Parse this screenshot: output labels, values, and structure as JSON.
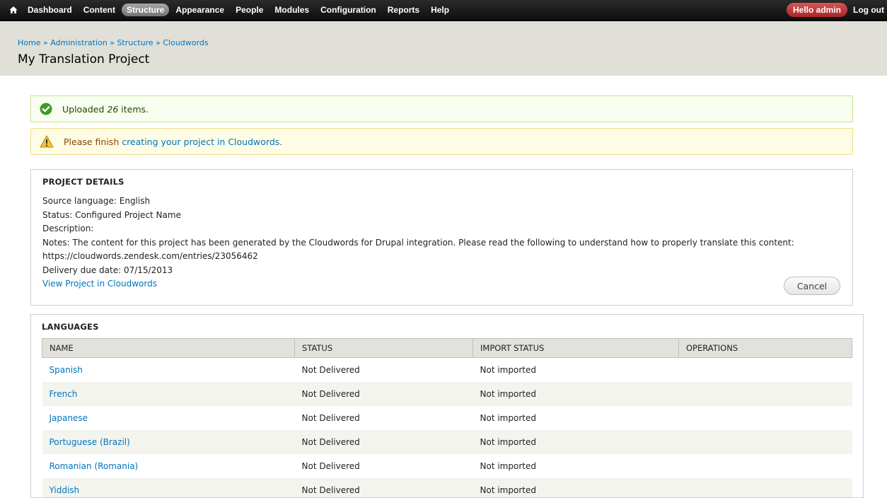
{
  "toolbar": {
    "nav": [
      "Dashboard",
      "Content",
      "Structure",
      "Appearance",
      "People",
      "Modules",
      "Configuration",
      "Reports",
      "Help"
    ],
    "active": "Structure",
    "hello": "Hello admin",
    "logout": "Log out"
  },
  "breadcrumb": [
    "Home",
    "Administration",
    "Structure",
    "Cloudwords"
  ],
  "breadcrumb_separator": "»",
  "page_title": "My Translation Project",
  "messages": {
    "status_prefix": "Uploaded ",
    "status_count": "26",
    "status_suffix": " items.",
    "warning_prefix": "Please finish ",
    "warning_link": "creating your project in Cloudwords",
    "warning_suffix": "."
  },
  "details": {
    "title": "PROJECT DETAILS",
    "lines": [
      "Source language: English",
      "Status: Configured Project Name",
      "Description:",
      "Notes: The content for this project has been generated by the Cloudwords for Drupal integration. Please read the following to understand how to properly translate this content:",
      "https://cloudwords.zendesk.com/entries/23056462",
      "Delivery due date: 07/15/2013"
    ],
    "link": "View Project in Cloudwords",
    "cancel": "Cancel"
  },
  "languages": {
    "title": "LANGUAGES",
    "columns": [
      "NAME",
      "STATUS",
      "IMPORT STATUS",
      "OPERATIONS"
    ],
    "rows": [
      {
        "name": "Spanish",
        "status": "Not Delivered",
        "import": "Not imported",
        "ops": ""
      },
      {
        "name": "French",
        "status": "Not Delivered",
        "import": "Not imported",
        "ops": ""
      },
      {
        "name": "Japanese",
        "status": "Not Delivered",
        "import": "Not imported",
        "ops": ""
      },
      {
        "name": "Portuguese (Brazil)",
        "status": "Not Delivered",
        "import": "Not imported",
        "ops": ""
      },
      {
        "name": "Romanian (Romania)",
        "status": "Not Delivered",
        "import": "Not imported",
        "ops": ""
      },
      {
        "name": "Yiddish",
        "status": "Not Delivered",
        "import": "Not imported",
        "ops": ""
      }
    ]
  },
  "icons": {
    "home": "home-icon",
    "status": "check-circle-icon",
    "warning": "warning-icon"
  },
  "colors": {
    "link": "#0074bd",
    "toolbar": "#1a1a1a",
    "hello_badge": "#c23b3b",
    "status_bg": "#f8fff0",
    "warning_bg": "#fffce5"
  }
}
